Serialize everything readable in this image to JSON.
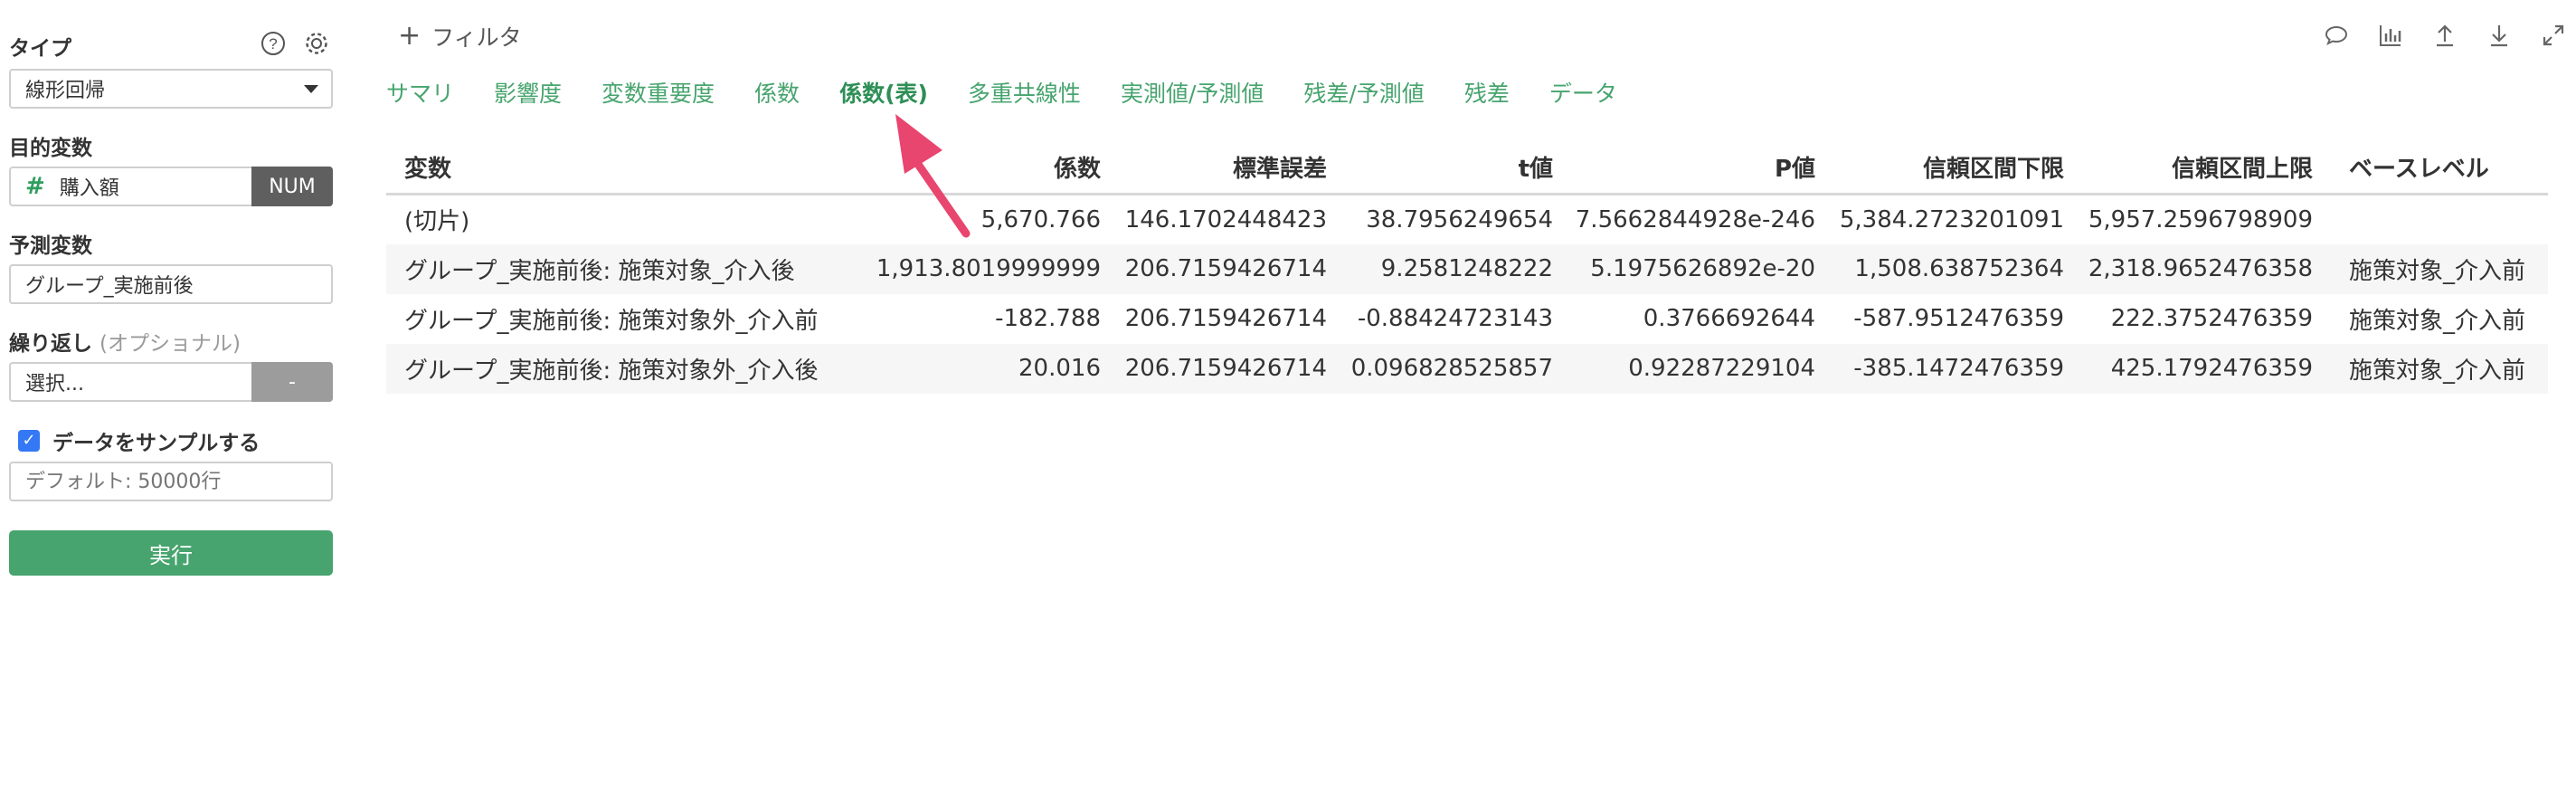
{
  "sidebar": {
    "type_label": "タイプ",
    "type_value": "線形回帰",
    "target_label": "目的変数",
    "target_value": "購入額",
    "target_badge": "NUM",
    "predictor_label": "予測変数",
    "predictor_value": "グループ_実施前後",
    "repeat_label": "繰り返し",
    "repeat_optional": "(オプショナル)",
    "repeat_value": "選択...",
    "repeat_badge": "-",
    "sample_label": "データをサンプルする",
    "sample_placeholder": "デフォルト: 50000行",
    "run_label": "実行"
  },
  "topbar": {
    "filter_label": "フィルタ"
  },
  "tabs": [
    {
      "label": "サマリ"
    },
    {
      "label": "影響度"
    },
    {
      "label": "変数重要度"
    },
    {
      "label": "係数"
    },
    {
      "label": "係数(表)"
    },
    {
      "label": "多重共線性"
    },
    {
      "label": "実測値/予測値"
    },
    {
      "label": "残差/予測値"
    },
    {
      "label": "残差"
    },
    {
      "label": "データ"
    }
  ],
  "table": {
    "headers": [
      "変数",
      "係数",
      "標準誤差",
      "t値",
      "P値",
      "信頼区間下限",
      "信頼区間上限",
      "ベースレベル"
    ],
    "rows": [
      [
        "(切片)",
        "5,670.766",
        "146.1702448423",
        "38.7956249654",
        "7.5662844928e-246",
        "5,384.2723201091",
        "5,957.2596798909",
        ""
      ],
      [
        "グループ_実施前後: 施策対象_介入後",
        "1,913.8019999999",
        "206.7159426714",
        "9.2581248222",
        "5.1975626892e-20",
        "1,508.638752364",
        "2,318.9652476358",
        "施策対象_介入前"
      ],
      [
        "グループ_実施前後: 施策対象外_介入前",
        "-182.788",
        "206.7159426714",
        "-0.88424723143",
        "0.3766692644",
        "-587.9512476359",
        "222.3752476359",
        "施策対象_介入前"
      ],
      [
        "グループ_実施前後: 施策対象外_介入後",
        "20.016",
        "206.7159426714",
        "0.096828525857",
        "0.92287229104",
        "-385.1472476359",
        "425.1792476359",
        "施策対象_介入前"
      ]
    ]
  },
  "colors": {
    "accent_green": "#47a46e",
    "checkbox_blue": "#3478f6",
    "arrow_pink": "#e8456f"
  }
}
